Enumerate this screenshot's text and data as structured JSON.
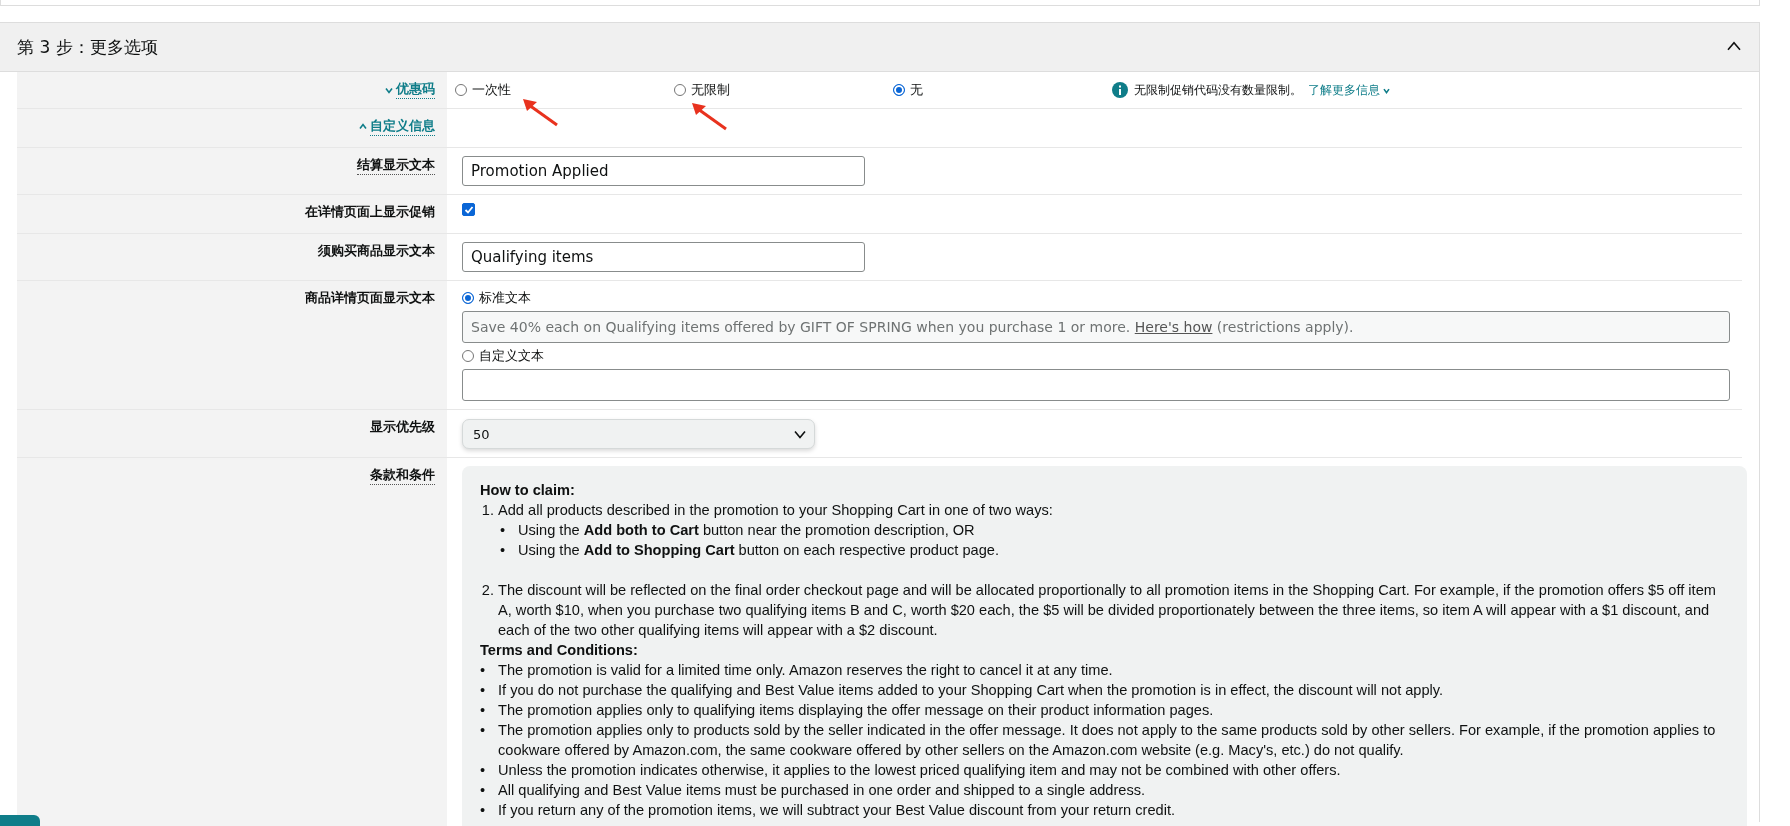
{
  "section": {
    "title": "第 3 步：更多选项",
    "expanded": true
  },
  "fields": [
    {
      "kind": "radio_group",
      "label": "优惠码",
      "label_expanded": false,
      "options": [
        {
          "label": "一次性",
          "selected": false,
          "marked": true
        },
        {
          "label": "无限制",
          "selected": false,
          "marked": true
        },
        {
          "label": "无",
          "selected": true,
          "marked": false
        }
      ],
      "info": {
        "text": "无限制促销代码没有数量限制。",
        "link": "了解更多信息"
      }
    },
    {
      "kind": "toggle",
      "label": "自定义信息",
      "label_expanded": true
    },
    {
      "kind": "text_input",
      "label": "结算显示文本",
      "value": "Promotion Applied"
    },
    {
      "kind": "checkbox",
      "label": "在详情页面上显示促销",
      "checked": true
    },
    {
      "kind": "text_input",
      "label": "须购买商品显示文本",
      "value": "Qualifying items"
    },
    {
      "kind": "text_choice",
      "label": "商品详情页面显示文本",
      "choices": [
        {
          "label": "标准文本",
          "selected": true,
          "text": {
            "before": "Save 40% each on Qualifying items offered by GIFT OF SPRING when you purchase 1 or more.",
            "link": "Here's how",
            "after": "(restrictions apply)."
          }
        },
        {
          "label": "自定义文本",
          "selected": false
        }
      ]
    },
    {
      "kind": "select",
      "label": "显示优先级",
      "value": "50"
    },
    {
      "kind": "terms",
      "label": "条款和条件",
      "blocks": [
        {
          "kind": "heading",
          "text": "How to claim:"
        },
        {
          "kind": "ordered",
          "items": [
            {
              "marker": "1.",
              "text": "Add all products described in the promotion to your Shopping Cart in one of two ways:",
              "children": [
                {
                  "marker": "•",
                  "text": "Using the **Add both to Cart** button near the promotion description, OR"
                },
                {
                  "marker": "•",
                  "text": "Using the **Add to Shopping Cart** button on each respective product page."
                }
              ]
            },
            {
              "marker": "2.",
              "text": "The discount will be reflected on the final order checkout page and will be allocated proportionally to all promotion items in the Shopping Cart. For example, if the promotion offers $5 off item A, worth $10, when you purchase two qualifying items B and C, worth $20 each, the $5 will be divided proportionately between the three items, so item A will appear with a $1 discount, and each of the two other qualifying items will appear with a $2 discount."
            }
          ]
        },
        {
          "kind": "heading",
          "text": "Terms and Conditions:"
        },
        {
          "kind": "bullets",
          "items": [
            {
              "marker": "•",
              "text": "The promotion is valid for a limited time only. Amazon reserves the right to cancel it at any time."
            },
            {
              "marker": "•",
              "text": "If you do not purchase the qualifying and Best Value items added to your Shopping Cart when the promotion is in effect, the discount will not apply."
            },
            {
              "marker": "•",
              "text": "The promotion applies only to qualifying items displaying the offer message on their product information pages."
            },
            {
              "marker": "•",
              "text": "The promotion applies only to products sold by the seller indicated in the offer message. It does not apply to the same products sold by other sellers. For example, if the promotion applies to cookware offered by Amazon.com, the same cookware offered by other sellers on the Amazon.com website (e.g. Macy's, etc.) do not qualify."
            },
            {
              "marker": "•",
              "text": "Unless the promotion indicates otherwise, it applies to the lowest priced qualifying item and may not be combined with other offers."
            },
            {
              "marker": "•",
              "text": "All qualifying and Best Value items must be purchased in one order and shipped to a single address."
            },
            {
              "marker": "•",
              "text": "If you return any of the promotion items, we will subtract your Best Value discount from your return credit."
            }
          ]
        }
      ]
    }
  ]
}
